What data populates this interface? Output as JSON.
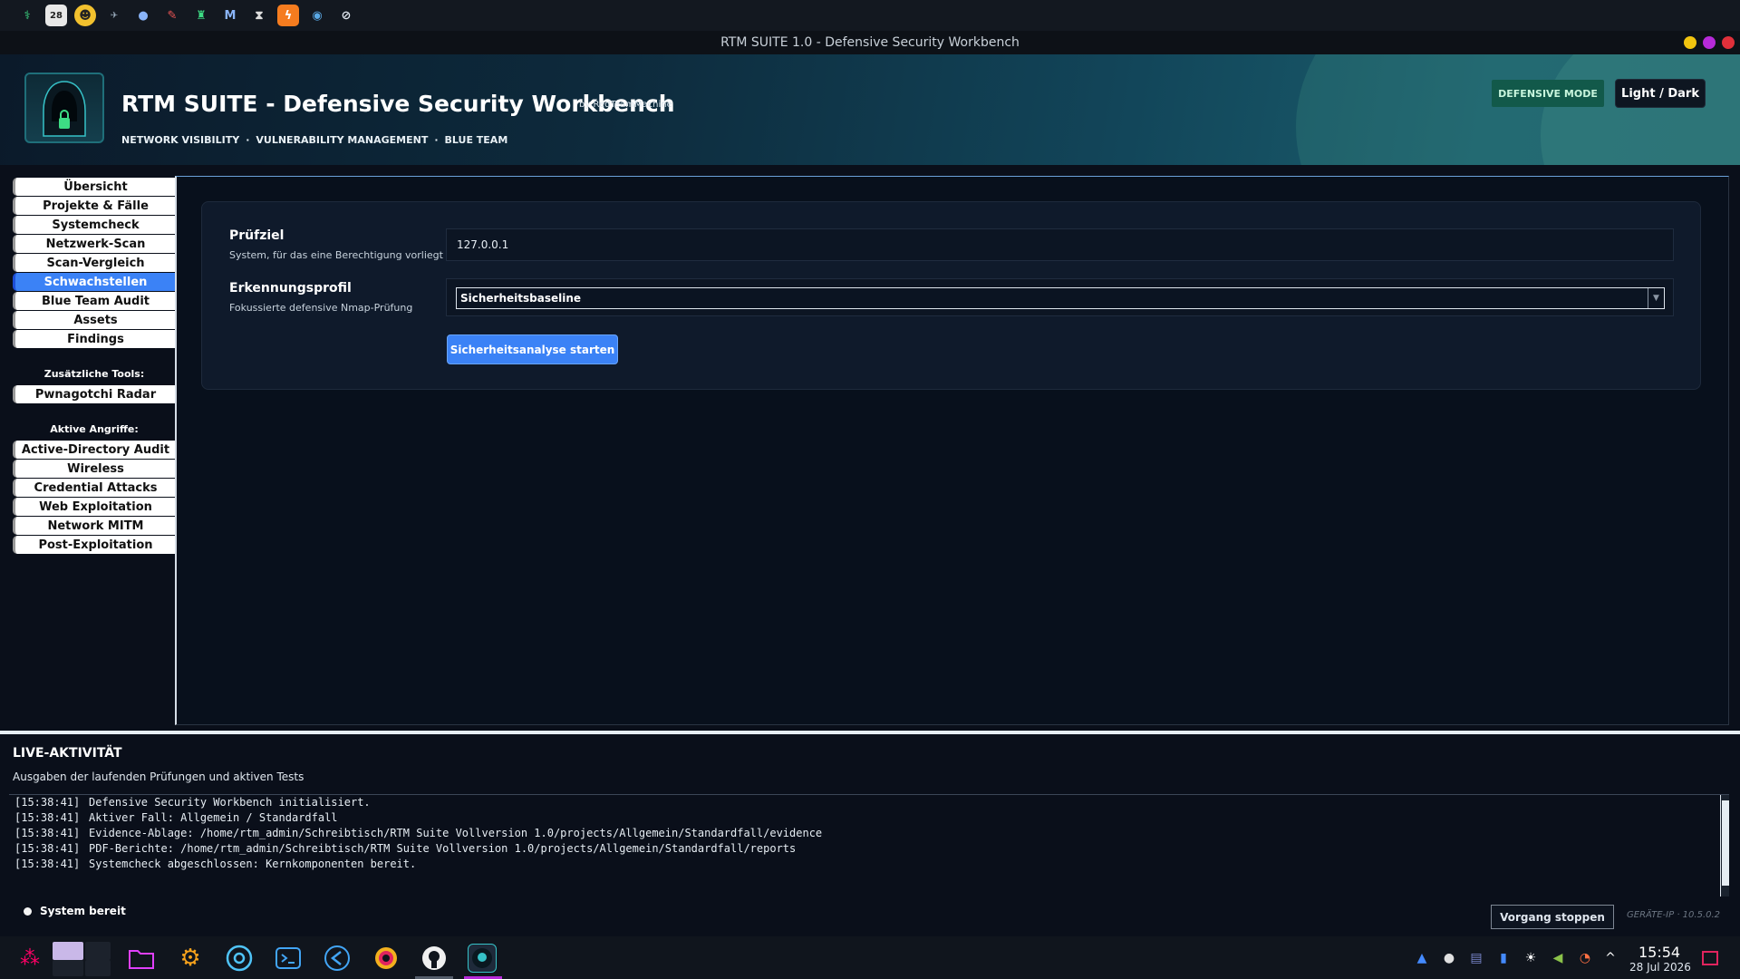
{
  "window": {
    "title": "RTM SUITE 1.0 - Defensive Security Workbench"
  },
  "header": {
    "title": "RTM SUITE - Defensive Security Workbench",
    "byline": "by RedTeamMachine",
    "tags": [
      "NETWORK VISIBILITY",
      "·",
      "VULNERABILITY MANAGEMENT",
      "·",
      "BLUE TEAM"
    ],
    "mode_badge": "DEFENSIVE MODE",
    "theme_toggle": "Light / Dark"
  },
  "sidebar": {
    "items": [
      {
        "label": "Übersicht"
      },
      {
        "label": "Projekte & Fälle"
      },
      {
        "label": "Systemcheck"
      },
      {
        "label": "Netzwerk-Scan"
      },
      {
        "label": "Scan-Vergleich"
      },
      {
        "label": "Schwachstellen",
        "active": true
      },
      {
        "label": "Blue Team Audit"
      },
      {
        "label": "Assets"
      },
      {
        "label": "Findings"
      }
    ],
    "tools_heading": "Zusätzliche Tools:",
    "tools": [
      {
        "label": "Pwnagotchi Radar"
      }
    ],
    "attacks_heading": "Aktive Angriffe:",
    "attacks": [
      {
        "label": "Active-Directory Audit"
      },
      {
        "label": "Wireless"
      },
      {
        "label": "Credential Attacks"
      },
      {
        "label": "Web Exploitation"
      },
      {
        "label": "Network MITM"
      },
      {
        "label": "Post-Exploitation"
      }
    ]
  },
  "form": {
    "target_label": "Prüfziel",
    "target_help": "System, für das eine Berechtigung vorliegt",
    "target_value": "127.0.0.1",
    "profile_label": "Erkennungsprofil",
    "profile_help": "Fokussierte defensive Nmap-Prüfung",
    "profile_value": "Sicherheitsbaseline",
    "start_button": "Sicherheitsanalyse starten"
  },
  "activity": {
    "title": "LIVE-AKTIVITÄT",
    "subtitle": "Ausgaben der laufenden Prüfungen und aktiven Tests",
    "log": [
      {
        "time": "[15:38:41]",
        "text": "Defensive Security Workbench initialisiert."
      },
      {
        "time": "[15:38:41]",
        "text": "Aktiver Fall: Allgemein / Standardfall"
      },
      {
        "time": "[15:38:41]",
        "text": "Evidence-Ablage: /home/rtm_admin/Schreibtisch/RTM Suite Vollversion 1.0/projects/Allgemein/Standardfall/evidence"
      },
      {
        "time": "[15:38:41]",
        "text": "PDF-Berichte: /home/rtm_admin/Schreibtisch/RTM Suite Vollversion 1.0/projects/Allgemein/Standardfall/reports"
      },
      {
        "time": "[15:38:41]",
        "text": "Systemcheck abgeschlossen: Kernkomponenten bereit."
      }
    ],
    "status": "System bereit",
    "stop_button": "Vorgang stoppen",
    "device_ip": "GERÄTE-IP · 10.5.0.2"
  },
  "top_panel": {
    "calendar_day": "28"
  },
  "taskbar": {
    "clock_time": "15:54",
    "clock_date": "28 Jul 2026"
  },
  "colors": {
    "accent": "#3b82f6",
    "mode_badge_bg": "#12594a",
    "background": "#0a0f1a"
  }
}
